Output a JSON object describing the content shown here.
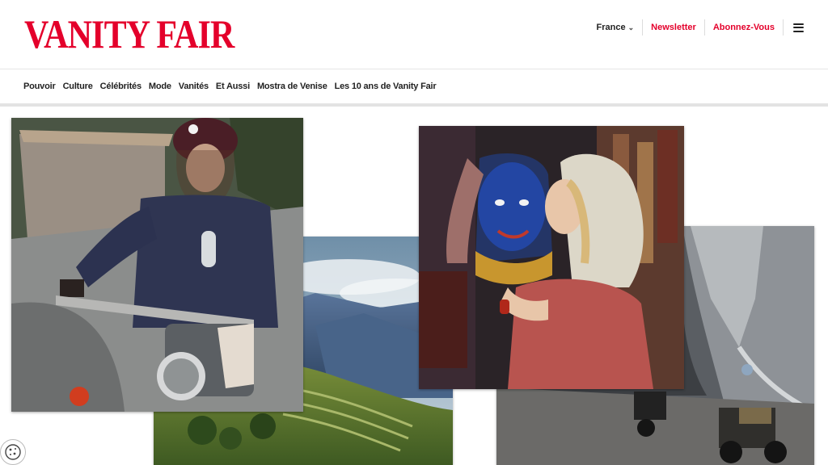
{
  "header": {
    "logo_text": "VANITY FAIR",
    "country": "France",
    "newsletter": "Newsletter",
    "subscribe": "Abonnez-Vous"
  },
  "nav": {
    "items": [
      "Pouvoir",
      "Culture",
      "Célébrités",
      "Mode",
      "Vanités",
      "Et Aussi",
      "Mostra de Venise",
      "Les 10 ans de Vanity Fair"
    ]
  },
  "colors": {
    "brand": "#e4002b",
    "text": "#222222"
  },
  "icons": {
    "country": "chevron-down-icon",
    "menu": "hamburger-menu-icon",
    "cookie": "cookie-icon"
  }
}
